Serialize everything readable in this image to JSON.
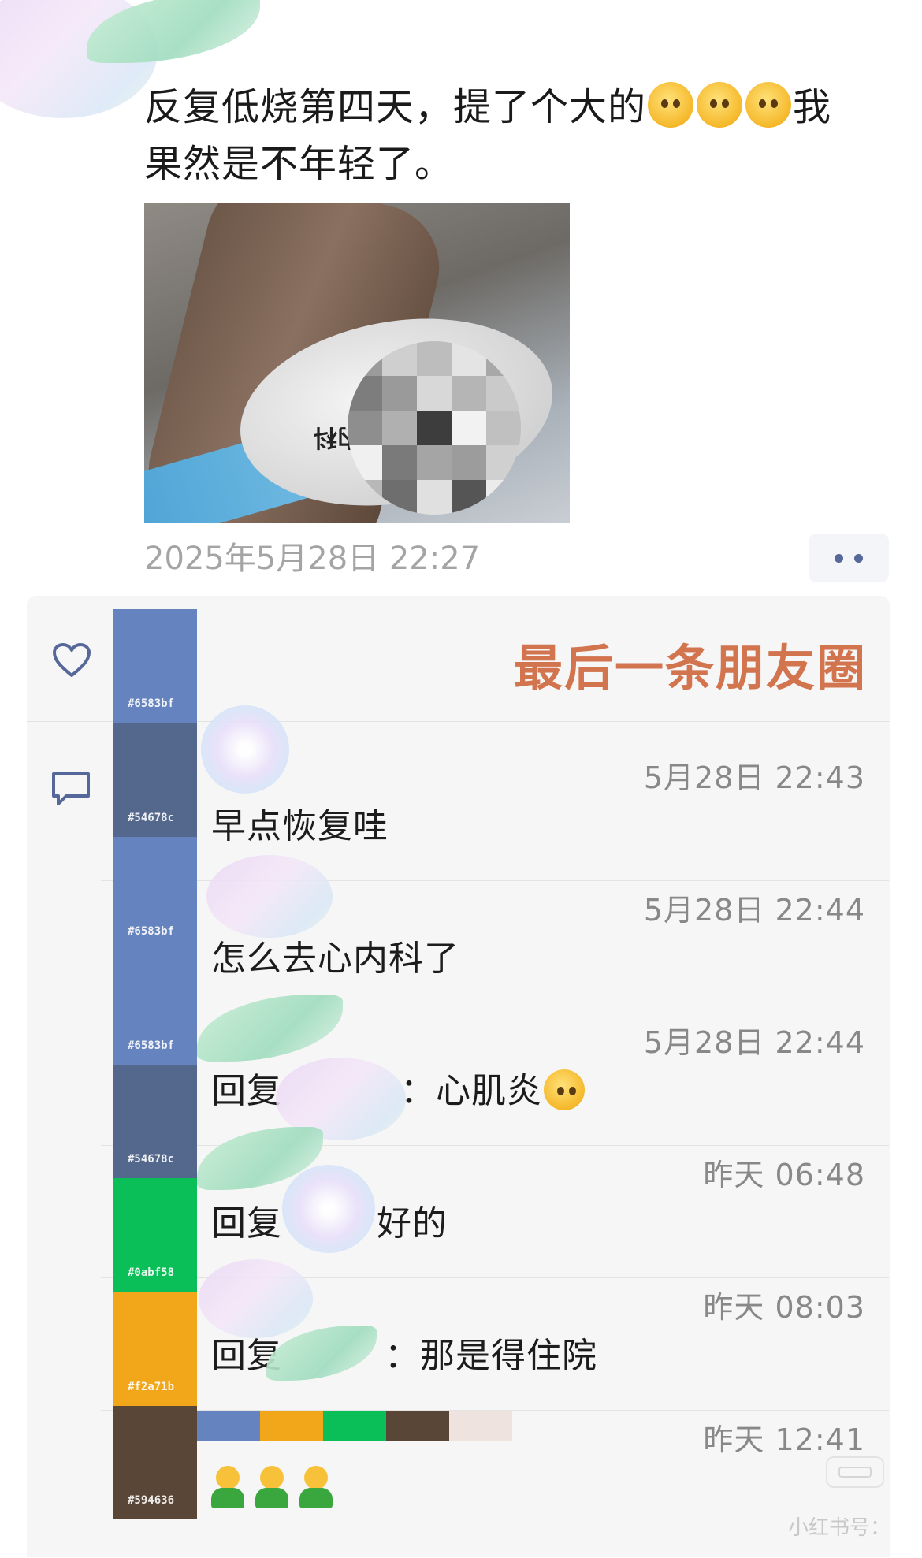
{
  "post": {
    "text_line1": "反复低烧第四天，提了个大的",
    "text_line1_tail": "我",
    "text_line2": "果然是不年轻了。",
    "timestamp": "2025年5月28日 22:27",
    "photo_band_text": "内科"
  },
  "overlay_title": "最后一条朋友圈",
  "comments": [
    {
      "time": "5月28日 22:43",
      "text": "早点恢复哇"
    },
    {
      "time": "5月28日 22:44",
      "text": "怎么去心内科了"
    },
    {
      "time": "5月28日 22:44",
      "reply_prefix": "回复",
      "text": "：心肌炎"
    },
    {
      "time": "昨天 06:48",
      "reply_prefix": "回复",
      "text": "好的"
    },
    {
      "time": "昨天 08:03",
      "reply_prefix": "回复",
      "text": "：那是得住院"
    },
    {
      "time": "昨天 12:41"
    }
  ],
  "palette": [
    {
      "hex": "#6583bf"
    },
    {
      "hex": "#54678c"
    },
    {
      "hex": "#6583bf"
    },
    {
      "hex": "#6583bf"
    },
    {
      "hex": "#54678c"
    },
    {
      "hex": "#0abf58"
    },
    {
      "hex": "#f2a71b"
    },
    {
      "hex": "#594636"
    }
  ],
  "palette_bar_colors": [
    "#6583bf",
    "#f2a71b",
    "#0abf58",
    "#594636",
    "#efe3df"
  ],
  "icons": {
    "like": "heart-icon",
    "comment": "comment-icon",
    "more": "more-dots-icon",
    "emoji_post": "face-with-peeking-eye-icon",
    "emoji_reply": "person-emoji-icon"
  },
  "colors": {
    "title_overlay": "#d2744e",
    "icon_blue": "#56689a"
  },
  "watermark": "小红书号："
}
